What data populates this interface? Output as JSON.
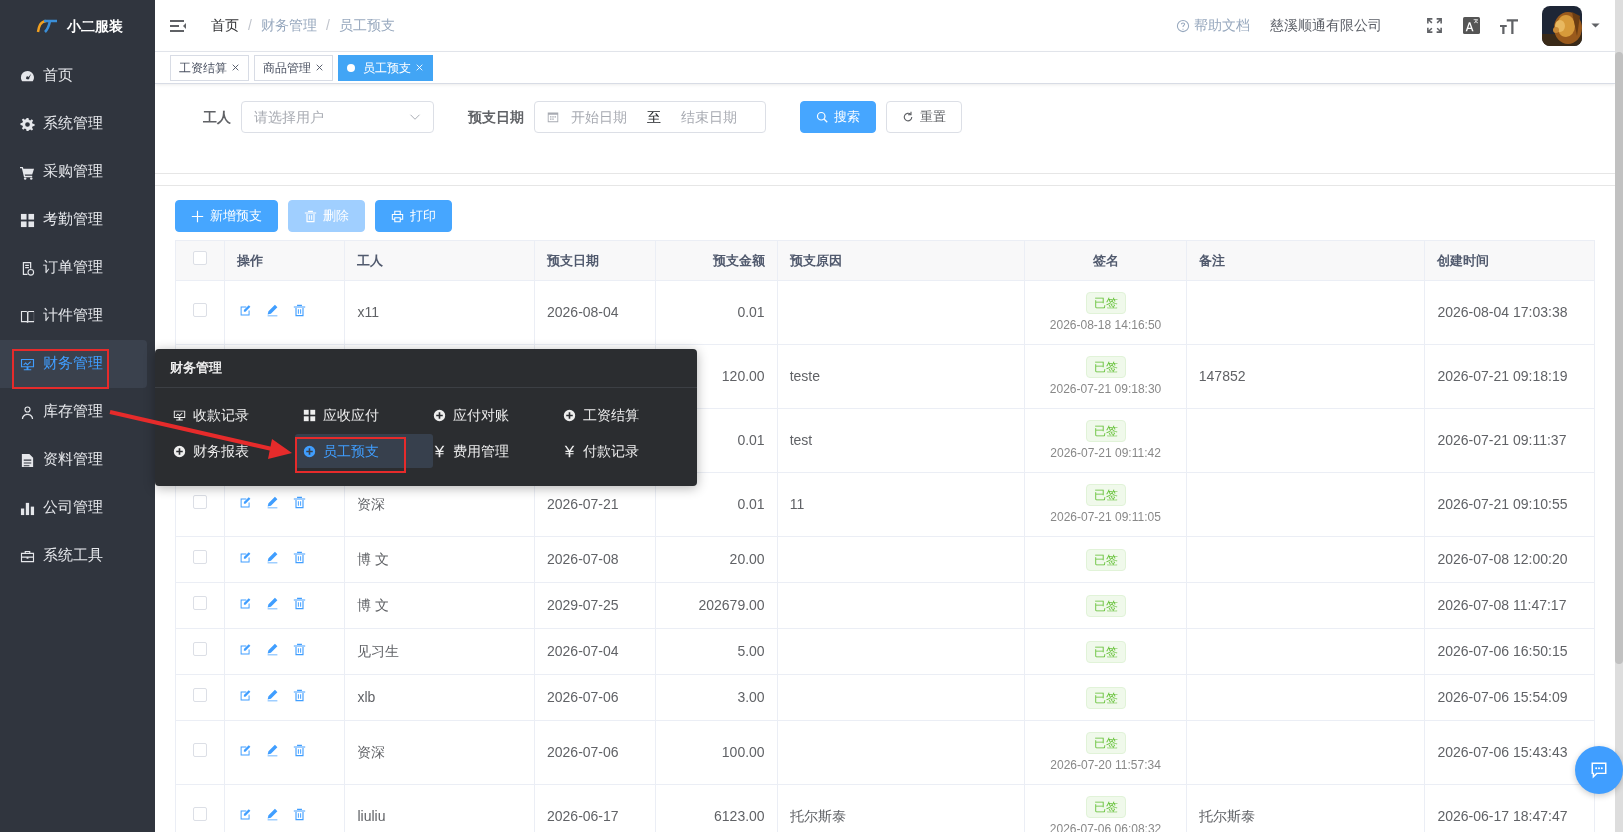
{
  "sidebar": {
    "logo": "小二服装",
    "items": [
      {
        "label": "首页",
        "selected": false
      },
      {
        "label": "系统管理",
        "selected": false
      },
      {
        "label": "采购管理",
        "selected": false
      },
      {
        "label": "考勤管理",
        "selected": false
      },
      {
        "label": "订单管理",
        "selected": false
      },
      {
        "label": "计件管理",
        "selected": false
      },
      {
        "label": "财务管理",
        "selected": true
      },
      {
        "label": "库存管理",
        "selected": false
      },
      {
        "label": "资料管理",
        "selected": false
      },
      {
        "label": "公司管理",
        "selected": false
      },
      {
        "label": "系统工具",
        "selected": false
      }
    ]
  },
  "popup_menu": {
    "title": "财务管理",
    "items": [
      {
        "label": "收款记录",
        "selected": false
      },
      {
        "label": "应收应付",
        "selected": false
      },
      {
        "label": "应付对账",
        "selected": false
      },
      {
        "label": "工资结算",
        "selected": false
      },
      {
        "label": "财务报表",
        "selected": false
      },
      {
        "label": "员工预支",
        "selected": true
      },
      {
        "label": "费用管理",
        "selected": false
      },
      {
        "label": "付款记录",
        "selected": false
      }
    ]
  },
  "breadcrumb": [
    "首页",
    "财务管理",
    "员工预支"
  ],
  "breadcrumb_separator": "/",
  "header": {
    "help": "帮助文档",
    "company": "慈溪顺通有限公司"
  },
  "tabs": [
    {
      "label": "工资结算",
      "selected": false
    },
    {
      "label": "商品管理",
      "selected": false
    },
    {
      "label": "员工预支",
      "selected": true
    }
  ],
  "filters": {
    "worker_label": "工人",
    "worker_placeholder": "请选择用户",
    "date_label": "预支日期",
    "start_placeholder": "开始日期",
    "range_separator": "至",
    "end_placeholder": "结束日期",
    "search": "搜索",
    "reset": "重置"
  },
  "toolbar": [
    {
      "label": "新增预支",
      "disabled": false
    },
    {
      "label": "删除",
      "disabled": true
    },
    {
      "label": "打印",
      "disabled": false
    }
  ],
  "table": {
    "select_all": false,
    "columns": [
      "操作",
      "工人",
      "预支日期",
      "预支金额",
      "预支原因",
      "签名",
      "备注",
      "创建时间"
    ],
    "rows": [
      {
        "checked": false,
        "worker": "x11",
        "date": "2026-08-04",
        "amount": "0.01",
        "sign": "已签",
        "sign_time": "2026-08-18 14:16:50",
        "created": "2026-08-04 17:03:38"
      },
      {
        "amount": "120.00",
        "reason": "teste",
        "sign": "已签",
        "sign_time": "2026-07-21 09:18:30",
        "remark": "147852",
        "created": "2026-07-21 09:18:19"
      },
      {
        "amount": "0.01",
        "reason": "test",
        "sign": "已签",
        "sign_time": "2026-07-21 09:11:42",
        "created": "2026-07-21 09:11:37"
      },
      {
        "checked": false,
        "worker": "资深",
        "date": "2026-07-21",
        "amount": "0.01",
        "reason": "11",
        "sign": "已签",
        "sign_time": "2026-07-21 09:11:05",
        "created": "2026-07-21 09:10:55"
      },
      {
        "checked": false,
        "worker": "博 文",
        "date": "2026-07-08",
        "amount": "20.00",
        "sign": "已签",
        "created": "2026-07-08 12:00:20"
      },
      {
        "checked": false,
        "worker": "博 文",
        "date": "2029-07-25",
        "amount": "202679.00",
        "sign": "已签",
        "created": "2026-07-08 11:47:17"
      },
      {
        "checked": false,
        "worker": "见习生",
        "date": "2026-07-04",
        "amount": "5.00",
        "sign": "已签",
        "created": "2026-07-06 16:50:15"
      },
      {
        "checked": false,
        "worker": "xlb",
        "date": "2026-07-06",
        "amount": "3.00",
        "sign": "已签",
        "created": "2026-07-06 15:54:09"
      },
      {
        "checked": false,
        "worker": "资深",
        "date": "2026-07-06",
        "amount": "100.00",
        "sign": "已签",
        "sign_time": "2026-07-20 11:57:34",
        "created": "2026-07-06 15:43:43"
      },
      {
        "checked": false,
        "worker": "liuliu",
        "date": "2026-06-17",
        "amount": "6123.00",
        "reason": "托尔斯泰",
        "sign": "已签",
        "sign_time": "2026-07-06 06:08:32",
        "remark": "托尔斯泰",
        "created": "2026-06-17 18:47:47"
      }
    ]
  }
}
